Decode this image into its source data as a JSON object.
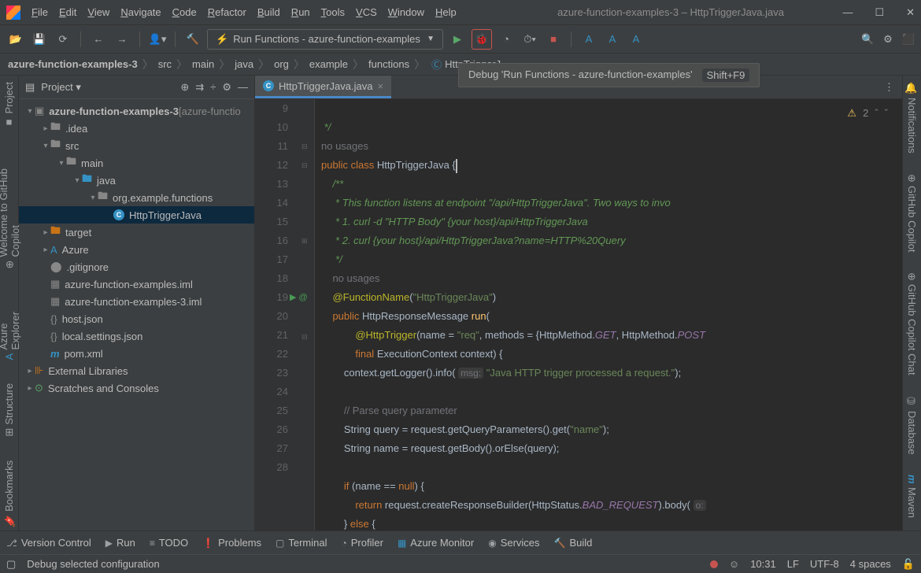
{
  "titlebar": {
    "menus": [
      "File",
      "Edit",
      "View",
      "Navigate",
      "Code",
      "Refactor",
      "Build",
      "Run",
      "Tools",
      "VCS",
      "Window",
      "Help"
    ],
    "title": "azure-function-examples-3 – HttpTriggerJava.java",
    "win": {
      "min": "—",
      "max": "☐",
      "close": "✕"
    }
  },
  "toolbar": {
    "run_config": "Run Functions - azure-function-examples"
  },
  "tooltip": {
    "text": "Debug 'Run Functions - azure-function-examples'",
    "shortcut": "Shift+F9"
  },
  "breadcrumb": {
    "items": [
      "azure-function-examples-3",
      "src",
      "main",
      "java",
      "org",
      "example",
      "functions"
    ],
    "file": "HttpTriggerJ"
  },
  "left_stripe": [
    "Project",
    "Welcome to GitHub Copilot",
    "Azure Explorer",
    "Structure",
    "Bookmarks"
  ],
  "right_stripe": [
    "Notifications",
    "GitHub Copilot",
    "GitHub Copilot Chat",
    "Database",
    "Maven"
  ],
  "project": {
    "header": "Project",
    "tree": {
      "root": "azure-function-examples-3",
      "root_suffix": " [azure-functio",
      "items": {
        "idea": ".idea",
        "src": "src",
        "main": "main",
        "java": "java",
        "pkg": "org.example.functions",
        "cls": "HttpTriggerJava",
        "target": "target",
        "azure": "Azure",
        "gi": ".gitignore",
        "iml1": "azure-function-examples.iml",
        "iml2": "azure-function-examples-3.iml",
        "host": "host.json",
        "local": "local.settings.json",
        "pom": "pom.xml",
        "ext": "External Libraries",
        "scr": "Scratches and Consoles"
      }
    }
  },
  "editor": {
    "tab": "HttpTriggerJava.java",
    "insp_count": "2",
    "lines": [
      "9",
      "",
      "10",
      "11",
      "12",
      "13",
      "14",
      "15",
      "",
      "16",
      "17",
      "18",
      "19",
      "20",
      "21",
      "22",
      "23",
      "24",
      "25",
      "26",
      "27",
      "28"
    ],
    "code": {
      "l9": " */",
      "hint1": "no usages",
      "l10_a": "public ",
      "l10_b": "class ",
      "l10_c": "HttpTriggerJava ",
      "l10_d": "{",
      "l11": "    /**",
      "l12": "     * This function listens at endpoint \"/api/HttpTriggerJava\". Two ways to invo",
      "l13": "     * 1. curl -d \"HTTP Body\" {your host}/api/HttpTriggerJava",
      "l14": "     * 2. curl {your host}/api/HttpTriggerJava?name=HTTP%20Query",
      "l15": "     */",
      "hint2": "    no usages",
      "l16_a": "    @FunctionName",
      "l16_b": "(",
      "l16_c": "\"HttpTriggerJava\"",
      "l16_d": ")",
      "l17_a": "    public ",
      "l17_b": "HttpResponseMessage ",
      "l17_c": "run",
      "l17_d": "(",
      "l18_a": "            @HttpTrigger",
      "l18_b": "(name = ",
      "l18_c": "\"req\"",
      "l18_d": ", methods = {HttpMethod.",
      "l18_e": "GET",
      "l18_f": ", HttpMethod.",
      "l18_g": "POST",
      "l19_a": "            final ",
      "l19_b": "ExecutionContext ",
      "l19_c": "context) {",
      "l20_a": "        context.getLogger().info( ",
      "l20_p": "msg:",
      "l20_b": " ",
      "l20_c": "\"Java HTTP trigger processed a request.\"",
      "l20_d": ");",
      "l22": "        // Parse query parameter",
      "l23_a": "        String ",
      "l23_b": "query",
      "l23_c": " = request.getQueryParameters().get(",
      "l23_d": "\"name\"",
      "l23_e": ");",
      "l24_a": "        String ",
      "l24_b": "name",
      "l24_c": " = request.getBody().orElse(query);",
      "l26_a": "        if ",
      "l26_b": "(name == ",
      "l26_c": "null",
      "l26_d": ") {",
      "l27_a": "            return ",
      "l27_b": "request.createResponseBuilder(HttpStatus.",
      "l27_c": "BAD_REQUEST",
      "l27_d": ").body( ",
      "l27_p": "o:",
      "l28_a": "        } ",
      "l28_b": "else ",
      "l28_c": "{"
    }
  },
  "bottom": {
    "items": [
      "Version Control",
      "Run",
      "TODO",
      "Problems",
      "Terminal",
      "Profiler",
      "Azure Monitor",
      "Services",
      "Build"
    ]
  },
  "status": {
    "left": "Debug selected configuration",
    "time": "10:31",
    "le": "LF",
    "enc": "UTF-8",
    "indent": "4 spaces"
  }
}
